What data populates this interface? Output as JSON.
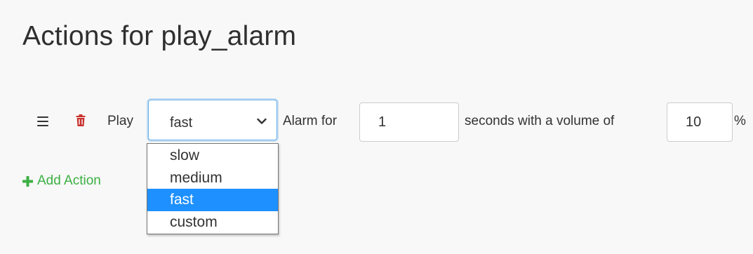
{
  "page": {
    "title": "Actions for play_alarm"
  },
  "action": {
    "play_label": "Play",
    "speed_select": {
      "selected_value": "fast",
      "options": [
        "slow",
        "medium",
        "fast",
        "custom"
      ]
    },
    "alarm_for_label": "Alarm for",
    "seconds_value": "1",
    "seconds_label": "seconds with a volume of",
    "volume_value": "10",
    "percent_label": "%"
  },
  "add_action": {
    "label": "Add Action"
  },
  "colors": {
    "background": "#f8f8f8",
    "delete_icon": "#c9302c",
    "add_action": "#3cb043",
    "focus_border": "#66afe9",
    "selected_option": "#1e90ff"
  },
  "icons": {
    "drag": "hamburger-drag-icon",
    "delete": "trash-icon",
    "dropdown": "chevron-down-icon",
    "add": "plus-icon"
  }
}
